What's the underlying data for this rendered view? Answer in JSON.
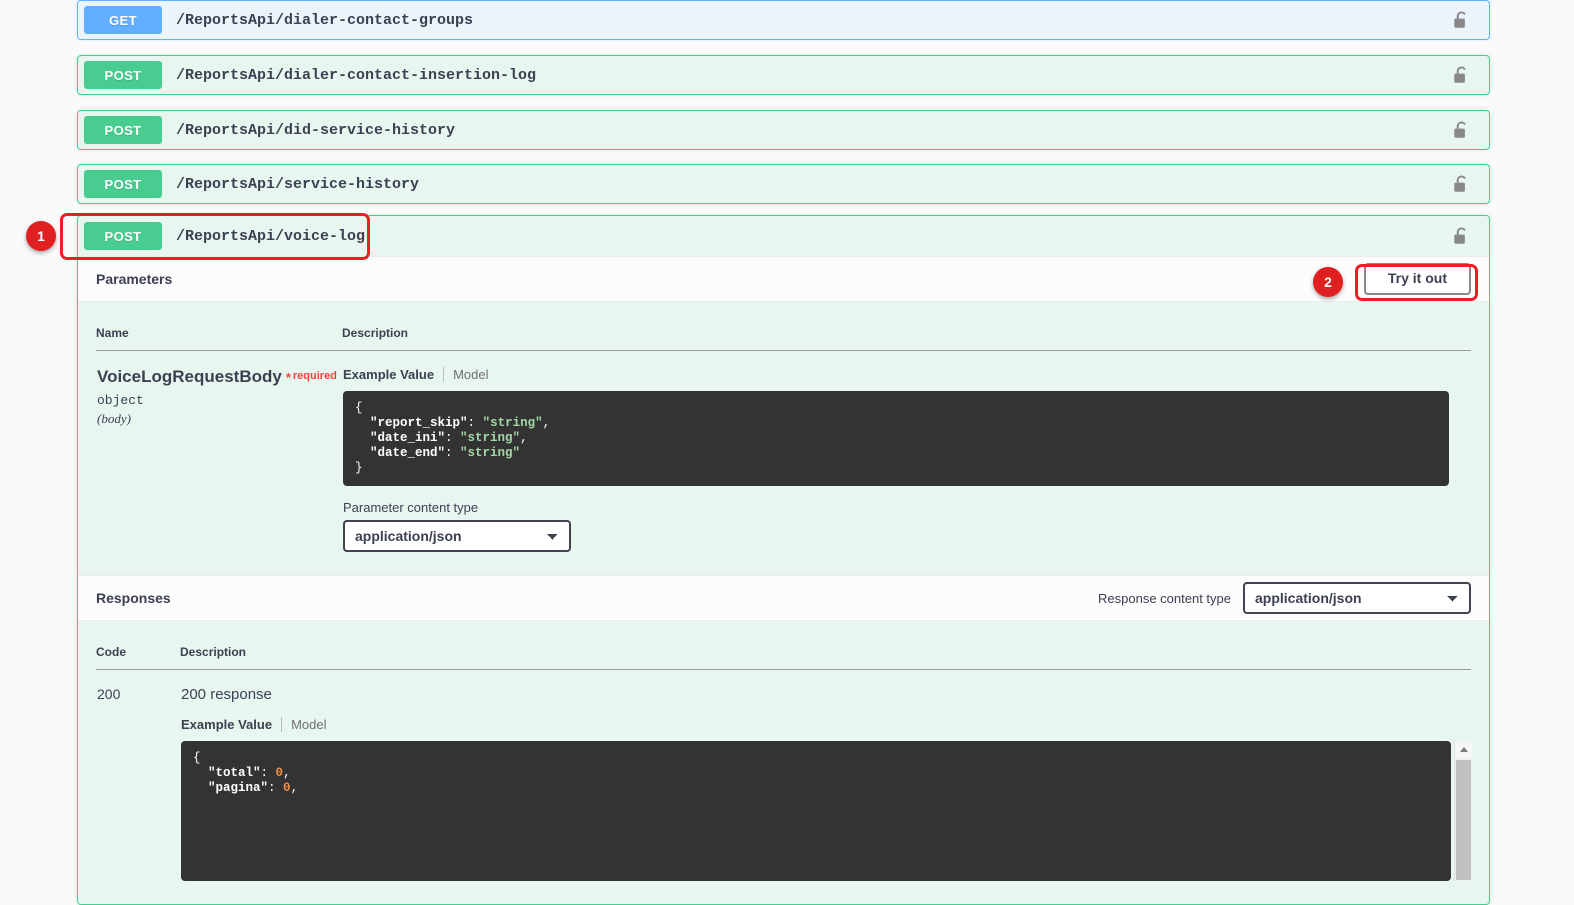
{
  "operations": [
    {
      "method": "GET",
      "path": "/ReportsApi/dialer-contact-groups",
      "lock": "unlocked-padlock-icon"
    },
    {
      "method": "POST",
      "path": "/ReportsApi/dialer-contact-insertion-log",
      "lock": "unlocked-padlock-icon"
    },
    {
      "method": "POST",
      "path": "/ReportsApi/did-service-history",
      "lock": "unlocked-padlock-icon"
    },
    {
      "method": "POST",
      "path": "/ReportsApi/service-history",
      "lock": "unlocked-padlock-icon"
    }
  ],
  "expanded_operation": {
    "method": "POST",
    "path": "/ReportsApi/voice-log",
    "lock": "unlocked-padlock-icon",
    "parameters_section": {
      "title": "Parameters",
      "try_it_out_label": "Try it out",
      "columns": {
        "name": "Name",
        "description": "Description"
      },
      "parameter": {
        "name": "VoiceLogRequestBody",
        "required_star": "*",
        "required_label": "required",
        "type": "object",
        "location": "(body)",
        "example_tab": "Example Value",
        "model_tab": "Model",
        "example_json": {
          "line1": "{",
          "line2_key": "\"report_skip\"",
          "line2_val": "\"string\"",
          "line3_key": "\"date_ini\"",
          "line3_val": "\"string\"",
          "line4_key": "\"date_end\"",
          "line4_val": "\"string\"",
          "line5": "}"
        },
        "content_type_label": "Parameter content type",
        "content_type_value": "application/json",
        "content_type_options": [
          "application/json"
        ]
      }
    },
    "responses_section": {
      "title": "Responses",
      "response_content_type_label": "Response content type",
      "response_content_type_value": "application/json",
      "response_content_type_options": [
        "application/json"
      ],
      "columns": {
        "code": "Code",
        "description": "Description"
      },
      "rows": [
        {
          "code": "200",
          "description": "200 response",
          "example_tab": "Example Value",
          "model_tab": "Model",
          "example_json": {
            "line1": "{",
            "line2_key": "\"total\"",
            "line2_val": "0",
            "line3_key": "\"pagina\"",
            "line3_val": "0"
          }
        }
      ]
    }
  },
  "annotations": [
    {
      "number": "1",
      "target": "post-voice-log-operation-row"
    },
    {
      "number": "2",
      "target": "try-it-out-button"
    }
  ],
  "colors": {
    "get": "#61affe",
    "post": "#49cc90",
    "required": "#f93e3e",
    "annotation": "#e02020",
    "code_background": "#333333",
    "string_value": "#a5d6a7",
    "number_value": "#f08d49",
    "panel_background": "#e8f6f0",
    "page_background": "#fafafa"
  },
  "scrollbar": {
    "arrow_icon": "chevron-up-icon"
  }
}
